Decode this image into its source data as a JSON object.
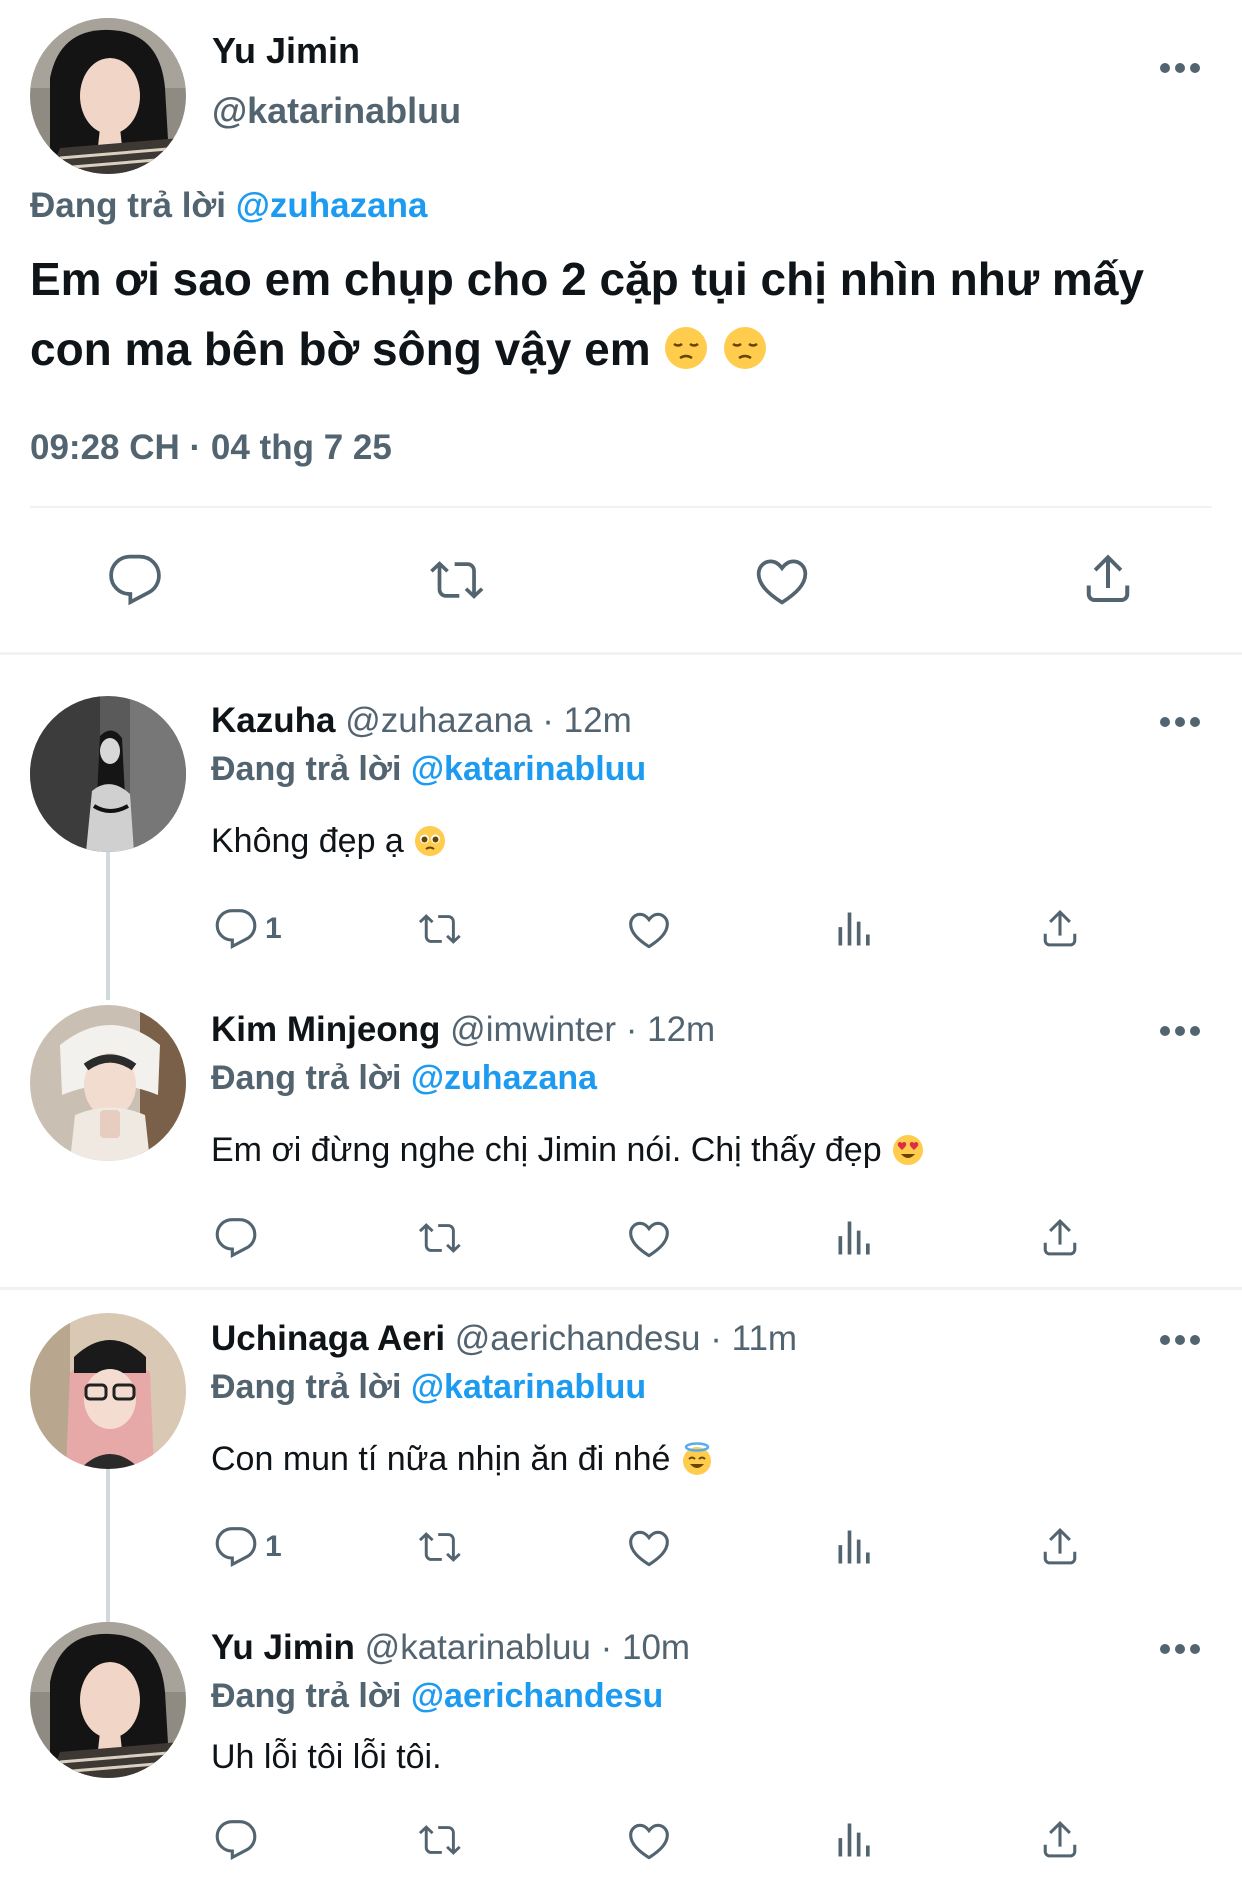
{
  "main_tweet": {
    "name": "Yu Jimin",
    "handle": "@katarinabluu",
    "replying_label": "Đang trả lời",
    "replying_to": "@zuhazana",
    "text": "Em ơi sao em chụp cho 2 cặp tụi chị nhìn như mấy con ma bên bờ sông vậy em",
    "timestamp": "09:28 CH · 04 thg 7 25",
    "actions": [
      "reply-icon",
      "retweet-icon",
      "like-icon",
      "share-icon"
    ]
  },
  "replies": [
    {
      "name": "Kazuha",
      "handle": "@zuhazana",
      "time": "· 12m",
      "replying_label": "Đang trả lời",
      "replying_to": "@katarinabluu",
      "text": "Không đẹp ạ",
      "emoji": "pleading-face",
      "reply_count": "1"
    },
    {
      "name": "Kim Minjeong",
      "handle": "@imwinter",
      "time": "· 12m",
      "replying_label": "Đang trả lời",
      "replying_to": "@zuhazana",
      "text": "Em ơi đừng nghe chị Jimin nói. Chị thấy đẹp",
      "emoji": "heart-eyes-face",
      "reply_count": ""
    },
    {
      "name": "Uchinaga Aeri",
      "handle": "@aerichandesu",
      "time": "· 11m",
      "replying_label": "Đang trả lời",
      "replying_to": "@katarinabluu",
      "text": "Con mun tí nữa nhịn ăn đi nhé",
      "emoji": "halo-face",
      "reply_count": "1"
    },
    {
      "name": "Yu Jimin",
      "handle": "@katarinabluu",
      "time": "· 10m",
      "replying_label": "Đang trả lời",
      "replying_to": "@aerichandesu",
      "text": "Uh lỗi tôi lỗi tôi.",
      "emoji": "",
      "reply_count": ""
    }
  ],
  "colors": {
    "text": "#0f1419",
    "secondary": "#536471",
    "link": "#1d9bf0",
    "divider": "#eff3f4",
    "thread_line": "#cfd9de"
  }
}
